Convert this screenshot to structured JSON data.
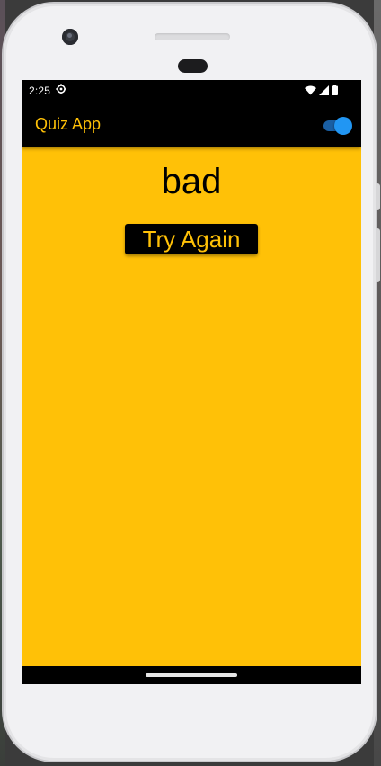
{
  "status_bar": {
    "time": "2:25",
    "icons": [
      "settings-icon",
      "wifi-icon",
      "signal-icon",
      "battery-icon"
    ]
  },
  "app_bar": {
    "title": "Quiz App",
    "theme_toggle_on": true
  },
  "result": {
    "text": "bad",
    "retry_label": "Try Again"
  },
  "colors": {
    "accent": "#ffc107",
    "background": "#ffc107",
    "app_bar": "#000000",
    "toggle": "#2196f3"
  }
}
